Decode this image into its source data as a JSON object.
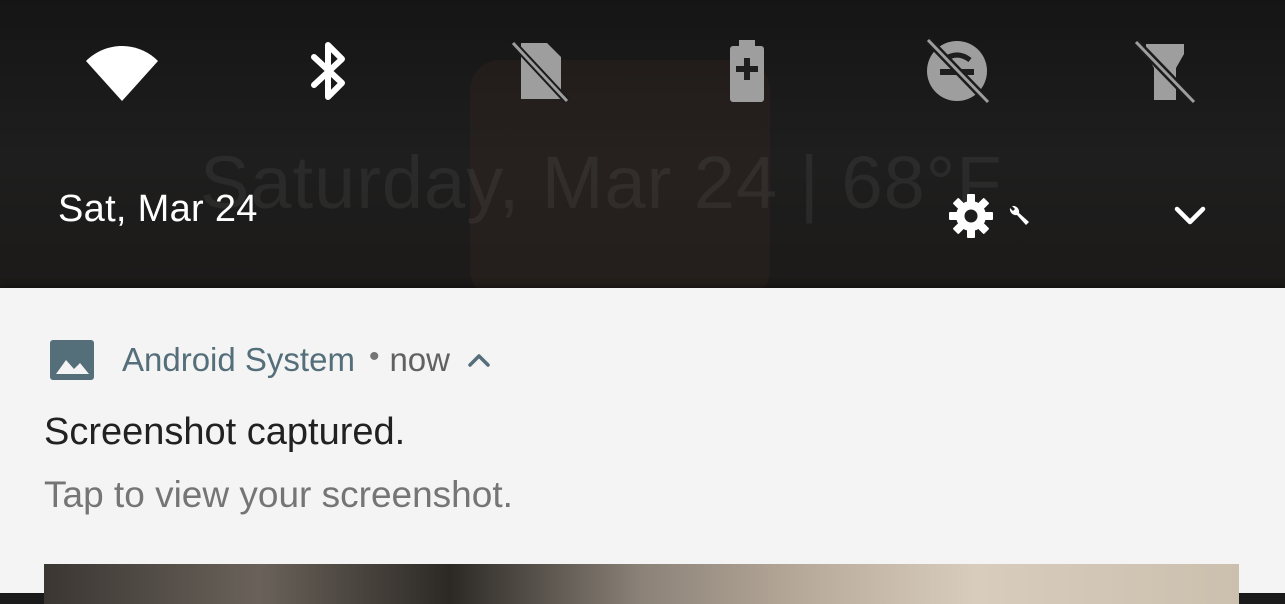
{
  "quick_settings": {
    "tiles": [
      {
        "id": "wifi",
        "icon": "wifi-icon",
        "state": "on"
      },
      {
        "id": "bluetooth",
        "icon": "bluetooth-icon",
        "state": "on"
      },
      {
        "id": "do-not-disturb",
        "icon": "do-not-disturb-off-icon",
        "state": "off"
      },
      {
        "id": "battery-saver",
        "icon": "battery-saver-icon",
        "state": "off"
      },
      {
        "id": "data-saver",
        "icon": "data-saver-off-icon",
        "state": "off"
      },
      {
        "id": "flashlight",
        "icon": "flashlight-off-icon",
        "state": "off"
      }
    ],
    "date": "Sat, Mar 24",
    "settings_icon": "gear-icon",
    "edit_icon": "wrench-icon",
    "expand_icon": "chevron-down-icon",
    "wallpaper_clock_text": "Saturday, Mar 24 | 68°F"
  },
  "notification": {
    "app_icon": "image-icon",
    "app_name": "Android System",
    "separator": "•",
    "time": "now",
    "collapse_icon": "chevron-up-icon",
    "title": "Screenshot captured.",
    "text": "Tap to view your screenshot."
  },
  "colors": {
    "shade_background": "#1b1b1b",
    "tile_active": "#ffffff",
    "tile_inactive": "#9e9e9e",
    "card_background": "#f4f4f4",
    "app_name": "#546e7a"
  }
}
